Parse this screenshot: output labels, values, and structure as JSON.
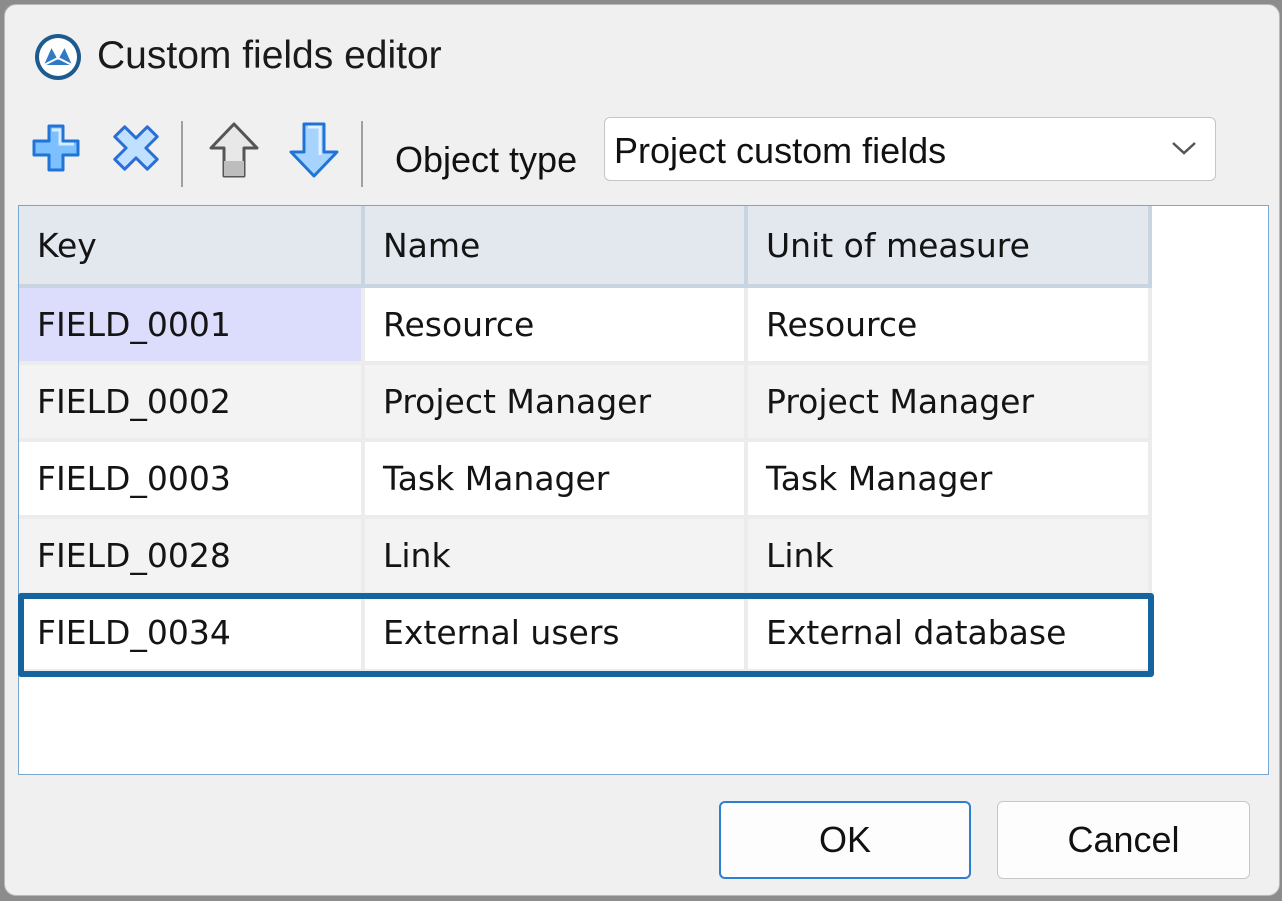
{
  "window": {
    "title": "Custom fields editor",
    "icon": "app-logo-icon"
  },
  "toolbar": {
    "buttons": [
      {
        "icon": "add-plus-icon",
        "label": "Add"
      },
      {
        "icon": "delete-x-icon",
        "label": "Delete"
      },
      {
        "icon": "arrow-up-icon",
        "label": "Move up"
      },
      {
        "icon": "arrow-down-icon",
        "label": "Move down"
      }
    ],
    "object_type_label": "Object type",
    "object_type_value": "Project custom fields"
  },
  "grid": {
    "columns": [
      "Key",
      "Name",
      "Unit of measure"
    ],
    "rows": [
      [
        "FIELD_0001",
        "Resource",
        "Resource"
      ],
      [
        "FIELD_0002",
        "Project Manager",
        "Project Manager"
      ],
      [
        "FIELD_0003",
        "Task Manager",
        "Task Manager"
      ],
      [
        "FIELD_0028",
        "Link",
        "Link"
      ],
      [
        "FIELD_0034",
        "External users",
        "External database"
      ]
    ],
    "selected_row": 0,
    "highlighted_row": 4
  },
  "buttons": {
    "ok": "OK",
    "cancel": "Cancel"
  },
  "colors": {
    "accent": "#1464a0",
    "header_bg": "#e3e8ef",
    "selection": "#dcdcfc",
    "icon_blue": "#2b8af0"
  }
}
